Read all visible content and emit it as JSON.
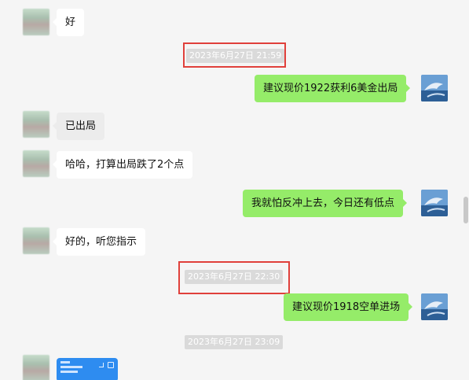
{
  "messages": [
    {
      "side": "in",
      "text": "好"
    },
    {
      "side": "out",
      "text": "建议现价1922获利6美金出局"
    },
    {
      "side": "in",
      "text": "已出局"
    },
    {
      "side": "in",
      "text": "哈哈，打算出局跌了2个点"
    },
    {
      "side": "out",
      "text": "我就怕反冲上去，今日还有低点"
    },
    {
      "side": "in",
      "text": "好的，听您指示"
    },
    {
      "side": "out",
      "text": "建议现价1918空单进场"
    }
  ],
  "timestamps": [
    {
      "text": "2023年6月27日 21:59",
      "highlighted": true
    },
    {
      "text": "2023年6月27日 22:30",
      "highlighted": true
    },
    {
      "text": "2023年6月27日 23:09",
      "highlighted": false
    }
  ],
  "colors": {
    "background": "#f5f5f5",
    "outgoing_bubble": "#95ec69",
    "incoming_bubble": "#ffffff",
    "highlight_box": "#e0403b",
    "timestamp_bg": "#dadada"
  },
  "icons": {
    "self_avatar": "dolphin-photo-avatar",
    "contact_avatar": "blurred-avatar",
    "image_message": "app-screenshot-thumbnail"
  }
}
